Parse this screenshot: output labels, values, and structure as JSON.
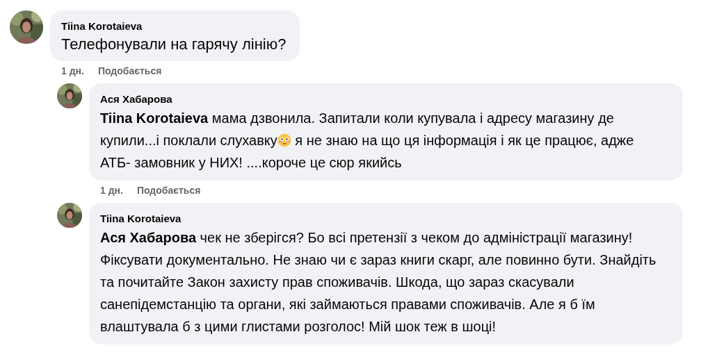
{
  "comments": [
    {
      "kind": "comment",
      "author": "Tiina Korotaieva",
      "body": [
        {
          "kind": "text",
          "text": "Телефонували на гарячу лінію?"
        }
      ],
      "time": "1 дн.",
      "like": "Подобається"
    },
    {
      "kind": "reply",
      "author": "Ася Хабарова",
      "body": [
        {
          "kind": "mention",
          "text": "Tiina Korotaieva"
        },
        {
          "kind": "text",
          "text": " мама дзвонила. Запитали коли купувала і адресу магазину де купили...і поклали слухавку"
        },
        {
          "kind": "emoji"
        },
        {
          "kind": "text",
          "text": " я не знаю на що ця інформація і як це працює, адже АТБ- замовник у НИХ! ....короче це сюр якийсь"
        }
      ],
      "time": "1 дн.",
      "like": "Подобається"
    },
    {
      "kind": "reply",
      "author": "Tiina Korotaieva",
      "body": [
        {
          "kind": "mention",
          "text": "Ася Хабарова"
        },
        {
          "kind": "text",
          "text": " чек не зберігся? Бо всі претензії з чеком до адміністрації магазину! Фіксувати документально. Не знаю чи є зараз книги скарг, але повинно бути. Знайдіть та почитайте Закон захисту прав споживачів. Шкода, що зараз скасували санепідемстанцію та органи, які займаються правами споживачів. Але я б їм влаштувала б з цими глистами розголос! Мій шок теж в шоці!"
        }
      ]
    }
  ]
}
